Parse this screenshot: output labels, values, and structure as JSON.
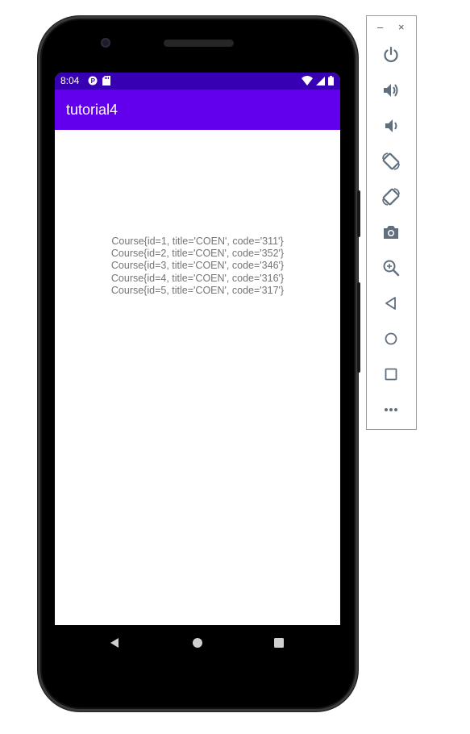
{
  "status_bar": {
    "time": "8:04",
    "left_icons": [
      "p-icon",
      "sd-card-icon"
    ],
    "right_icons": [
      "wifi-icon",
      "signal-icon",
      "battery-icon"
    ]
  },
  "app_bar": {
    "title": "tutorial4",
    "color": "#6200ee",
    "status_color": "#3700b3"
  },
  "courses": [
    "Course{id=1, title='COEN', code='311'}",
    "Course{id=2, title='COEN', code='352'}",
    "Course{id=3, title='COEN', code='346'}",
    "Course{id=4, title='COEN', code='316'}",
    "Course{id=5, title='COEN', code='317'}"
  ],
  "nav_bar": {
    "buttons": [
      "back-icon",
      "home-icon",
      "recents-icon"
    ]
  },
  "emulator_toolbar": {
    "window_controls": {
      "minimize": "–",
      "close": "×"
    },
    "items": [
      "power-icon",
      "volume-up-icon",
      "volume-down-icon",
      "rotate-left-icon",
      "rotate-right-icon",
      "camera-icon",
      "zoom-icon",
      "back-icon",
      "home-icon",
      "overview-icon",
      "more-icon"
    ],
    "icon_color": "#5f6f7d"
  }
}
